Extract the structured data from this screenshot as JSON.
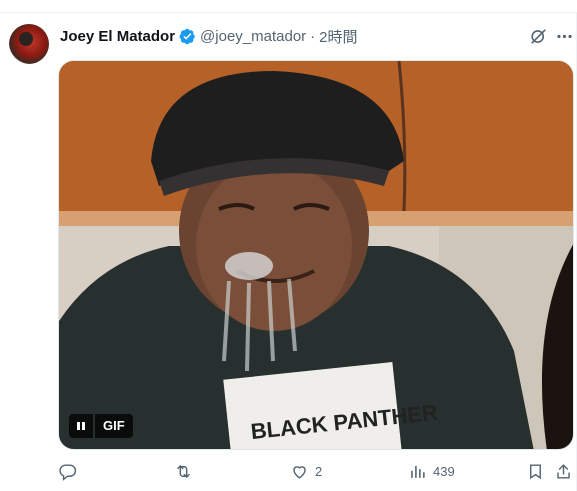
{
  "tweet": {
    "display_name": "Joey El Matador",
    "handle": "@joey_matador",
    "separator": "·",
    "time": "2時間",
    "verified_icon": "verified-badge-icon",
    "media": {
      "type": "gif",
      "badge": "GIF",
      "shirt_text": "BLACK PANTHER"
    },
    "actions": {
      "reply_count": "",
      "retweet_count": "",
      "like_count": "2",
      "views_count": "439"
    },
    "colors": {
      "verified_blue": "#1d9bf0",
      "secondary_text": "#536471",
      "primary_text": "#0f1419"
    }
  }
}
